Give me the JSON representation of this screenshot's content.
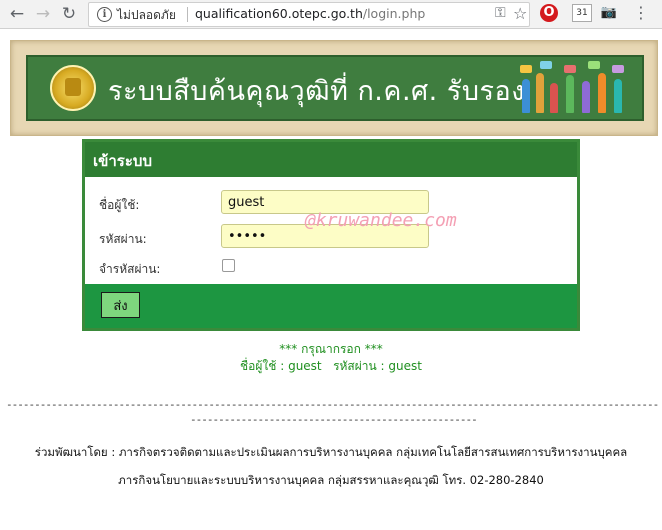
{
  "browser": {
    "security_label": "ไม่ปลอดภัย",
    "url_host": "qualification60.otepc.go.th",
    "url_path": "/login.php",
    "calendar_day": "31"
  },
  "banner": {
    "title": "ระบบสืบค้นคุณวุฒิที่ ก.ค.ศ. รับรอง"
  },
  "login": {
    "title": "เข้าระบบ",
    "username_label": "ชื่อผู้ใช้:",
    "username_value": "guest",
    "password_label": "รหัสผ่าน:",
    "password_value": "guest",
    "remember_label": "จำรหัสผ่าน:",
    "submit_label": "ส่ง",
    "watermark": "@kruwandee.com"
  },
  "hint": {
    "line1": "*** กรุณากรอก ***",
    "line2": "ชื่อผู้ใช้ : guest   รหัสผ่าน : guest"
  },
  "footer": {
    "dashes_long": "-----------------------------------------------------------------------------------------------------------------------------------",
    "dashes_short": "-------------------------------------------------------------------------------------",
    "line1": "ร่วมพัฒนาโดย : ภารกิจตรวจติดตามและประเมินผลการบริหารงานบุคคล กลุ่มเทคโนโลยีสารสนเทศการบริหารงานบุคคล",
    "line2": "ภารกิจนโยบายและระบบบริหารงานบุคคล กลุ่มสรรหาและคุณวุฒิ  โทร. 02-280-2840"
  },
  "colors": {
    "header_green": "#2e7d32",
    "footer_green": "#1d9641",
    "button_green": "#7ed67e",
    "input_yellow": "#fdfdc6"
  }
}
